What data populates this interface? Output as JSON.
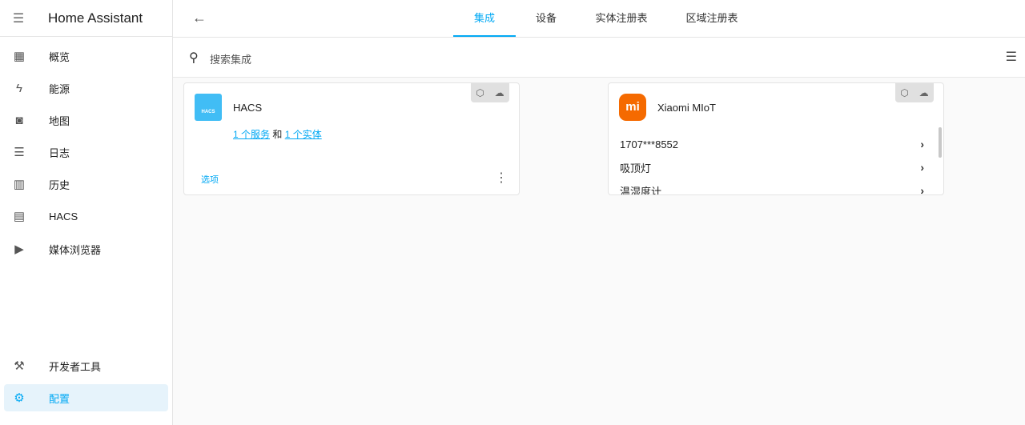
{
  "app": {
    "title": "Home Assistant"
  },
  "sidebar": {
    "items": [
      {
        "label": "概览",
        "icon": "dashboard-icon"
      },
      {
        "label": "能源",
        "icon": "lightning-icon"
      },
      {
        "label": "地图",
        "icon": "map-icon"
      },
      {
        "label": "日志",
        "icon": "list-icon"
      },
      {
        "label": "历史",
        "icon": "chart-icon"
      },
      {
        "label": "HACS",
        "icon": "hacs-icon"
      },
      {
        "label": "媒体浏览器",
        "icon": "media-icon"
      }
    ],
    "bottom": [
      {
        "label": "开发者工具",
        "icon": "hammer-icon"
      },
      {
        "label": "配置",
        "icon": "gear-icon"
      }
    ]
  },
  "tabs": [
    {
      "label": "集成"
    },
    {
      "label": "设备"
    },
    {
      "label": "实体注册表"
    },
    {
      "label": "区域注册表"
    }
  ],
  "search": {
    "placeholder": "搜索集成"
  },
  "cards": {
    "hacs": {
      "name": "HACS",
      "link1": "1 个服务",
      "and": "和",
      "link2": "1 个实体",
      "options": "选项",
      "logo_text": "HACS"
    },
    "xiaomi": {
      "name": "Xiaomi MIoT",
      "logo_text": "mi",
      "rows": [
        "1707***8552",
        "吸顶灯",
        "温湿度计"
      ]
    }
  },
  "colors": {
    "accent": "#03a9f4",
    "xiaomi": "#f56a00"
  }
}
